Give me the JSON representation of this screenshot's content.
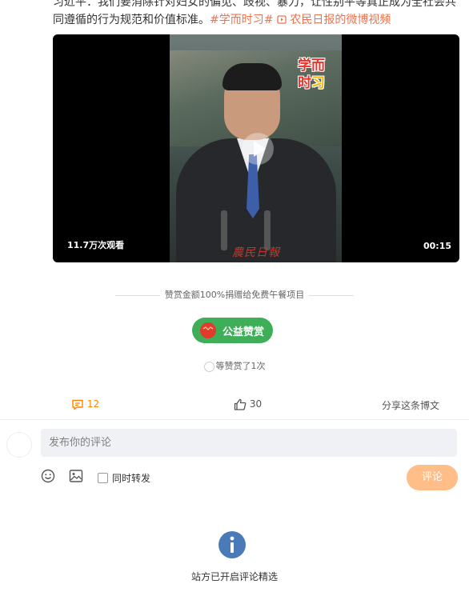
{
  "post": {
    "line1": "习近平：我们要消除针对妇女的偏见、歧视、暴力，让性别平等真正成为全社会共",
    "line2": "同遵循的行为规范和价值标准。",
    "tag1": "#学而时习#",
    "tag2": "农民日报的微博视频"
  },
  "video": {
    "logo_line1": "学而",
    "logo_line2a": "时",
    "logo_line2b": "习",
    "seal_text": "農民日報",
    "views": "11.7万次观看",
    "duration": "00:15"
  },
  "reward": {
    "note": "赞赏金额100%捐赠给免费午餐项目",
    "button_logo": "农民日报",
    "button_label": "公益赞赏",
    "count_text": "等赞赏了1次"
  },
  "actions": {
    "comment_count": "12",
    "like_count": "30",
    "share_label": "分享这条博文"
  },
  "comment_box": {
    "placeholder": "发布你的评论",
    "forward_label": "同时转发",
    "submit_label": "评论"
  },
  "notice": {
    "text": "站方已开启评论精选"
  },
  "colors": {
    "accent": "#eb7350",
    "reward_green": "#3fae58",
    "submit_orange": "#ffbe88",
    "info_blue": "#4a7ab8"
  }
}
